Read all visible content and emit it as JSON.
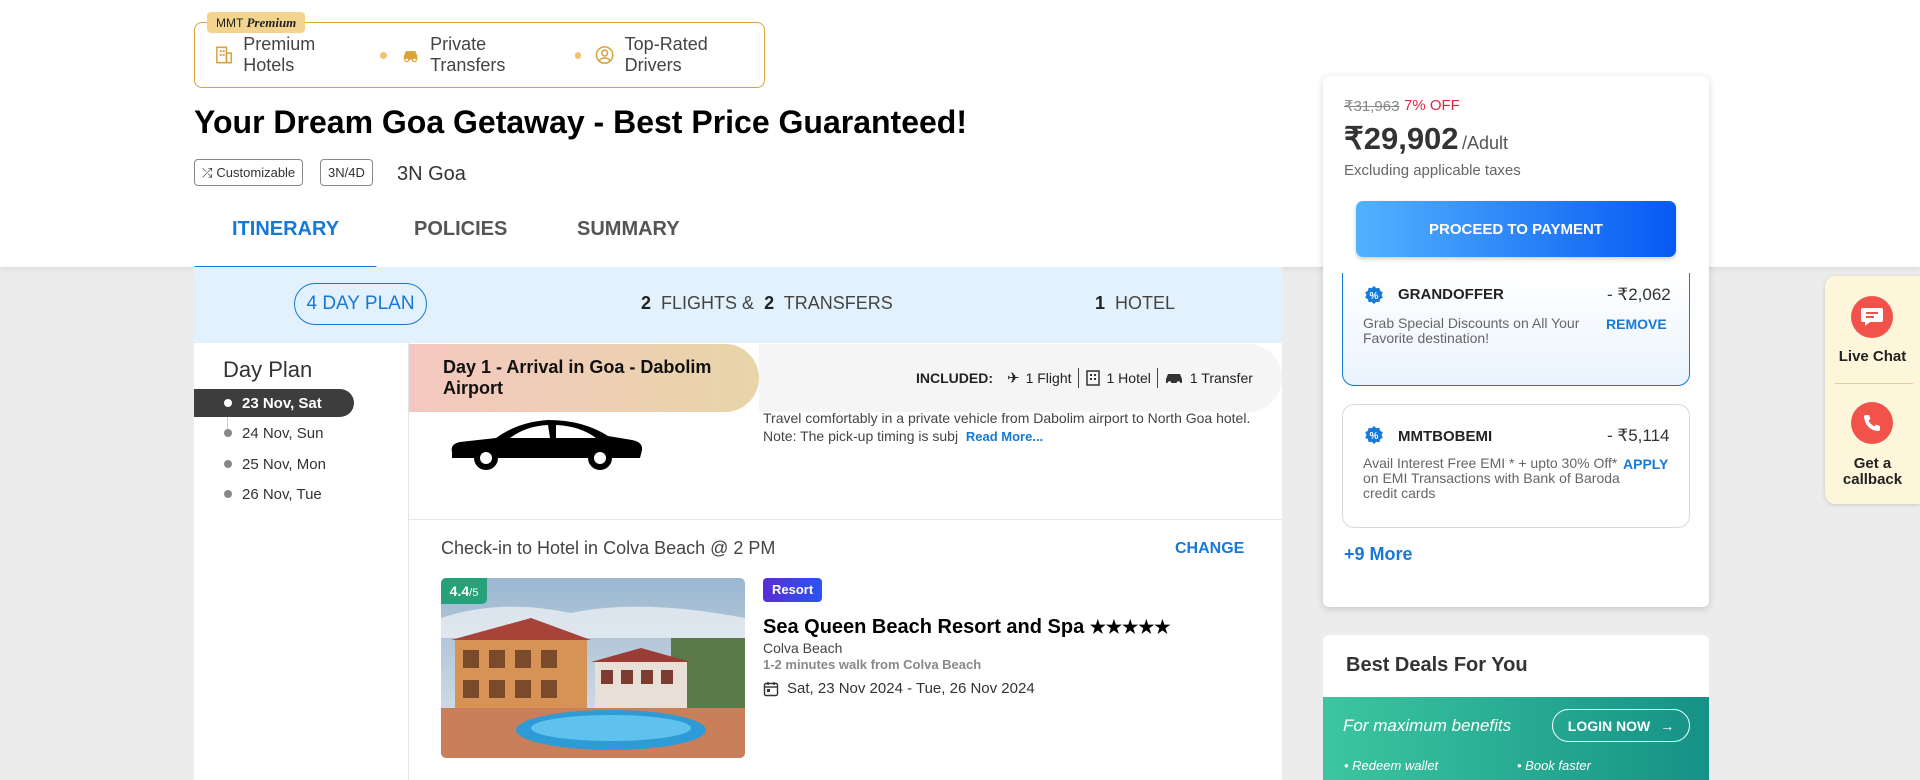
{
  "premium": {
    "tag_prefix": "MMT",
    "tag_italic": "Premium",
    "features": [
      "Premium Hotels",
      "Private Transfers",
      "Top-Rated Drivers"
    ]
  },
  "title": "Your Dream Goa Getaway - Best Price Guaranteed!",
  "chips": [
    "Customizable",
    "3N/4D"
  ],
  "destination": "3N Goa",
  "tabs": [
    "ITINERARY",
    "POLICIES",
    "SUMMARY"
  ],
  "plan_bar": {
    "day_count": "4",
    "day_label": "DAY PLAN",
    "flights_count": "2",
    "flights_label": "FLIGHTS &",
    "transfers_count": "2",
    "transfers_label": "TRANSFERS",
    "hotel_count": "1",
    "hotel_label": "HOTEL"
  },
  "day_plan": {
    "title": "Day Plan",
    "days": [
      "23 Nov, Sat",
      "24 Nov, Sun",
      "25 Nov, Mon",
      "26 Nov, Tue"
    ]
  },
  "day1": {
    "title": "Day 1 - Arrival in Goa - Dabolim Airport",
    "included_label": "INCLUDED:",
    "included": [
      "1 Flight",
      "1 Hotel",
      "1 Transfer"
    ],
    "description": "Travel comfortably in a private vehicle from Dabolim airport to North Goa hotel. Note: The pick-up timing is subj",
    "read_more": "Read More..."
  },
  "hotel": {
    "checkin": "Check-in to Hotel in Colva Beach @ 2 PM",
    "change": "CHANGE",
    "rating": "4.4",
    "rating_suffix": "/5",
    "tag": "Resort",
    "name": "Sea Queen Beach Resort and Spa",
    "stars": "★★★★★",
    "location": "Colva Beach",
    "walk": "1-2 minutes walk from Colva Beach",
    "dates": "Sat, 23 Nov 2024 - Tue, 26 Nov 2024"
  },
  "pricing": {
    "original": "₹31,963",
    "discount": "7% OFF",
    "price": "₹29,902",
    "per": "/Adult",
    "note": "Excluding applicable taxes",
    "cta": "PROCEED TO PAYMENT"
  },
  "coupons": [
    {
      "code": "GRANDOFFER",
      "amount": "- ₹2,062",
      "desc": "Grab Special Discounts on All Your Favorite destination!",
      "action": "REMOVE"
    },
    {
      "code": "MMTBOBEMI",
      "amount": "- ₹5,114",
      "desc": "Avail Interest Free EMI * + upto 30% Off* on EMI Transactions with Bank of Baroda credit cards",
      "action": "APPLY"
    }
  ],
  "more_coupons": "+9 More",
  "deals": {
    "title": "Best Deals For You",
    "text": "For maximum benefits",
    "login": "LOGIN NOW",
    "bullets": [
      "Redeem wallet",
      "Book faster"
    ]
  },
  "side_widget": {
    "chat": "Live Chat",
    "callback": "Get a callback"
  },
  "colors": {
    "accent": "#1678d8",
    "discount": "#e0283c",
    "premium_gold": "#d9a33a",
    "rating_green": "#27a17a"
  }
}
